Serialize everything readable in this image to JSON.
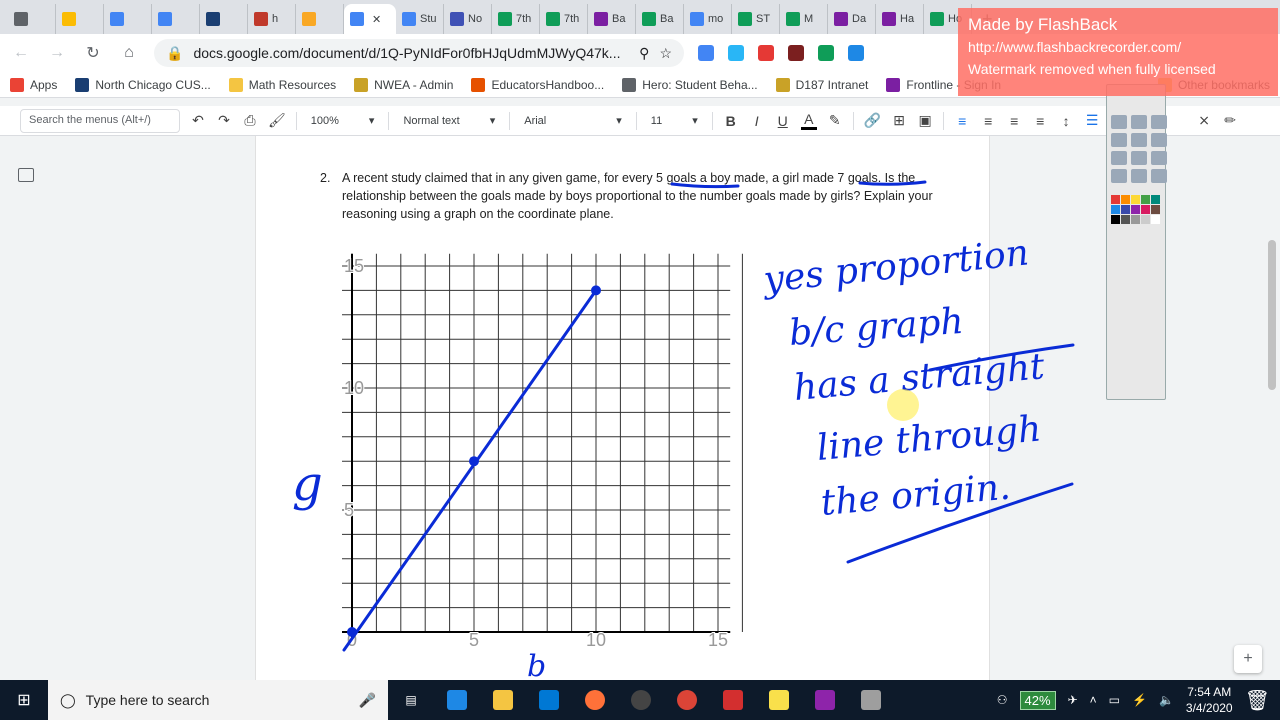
{
  "browser": {
    "tabs": [
      {
        "label": "",
        "color": "#5f6368"
      },
      {
        "label": "",
        "color": "#fbbc04"
      },
      {
        "label": "",
        "color": "#4285f4"
      },
      {
        "label": "",
        "color": "#4285f4"
      },
      {
        "label": "",
        "color": "#1a3e72"
      },
      {
        "label": "h",
        "color": "#c0392b"
      },
      {
        "label": "",
        "color": "#f9a825"
      },
      {
        "label": "",
        "color": "#4285f4",
        "active": true
      },
      {
        "label": "Stu",
        "color": "#4285f4"
      },
      {
        "label": "No",
        "color": "#3f51b5"
      },
      {
        "label": "7th",
        "color": "#0f9d58"
      },
      {
        "label": "7th",
        "color": "#0f9d58"
      },
      {
        "label": "Ba",
        "color": "#7b1fa2"
      },
      {
        "label": "Ba",
        "color": "#0f9d58"
      },
      {
        "label": "mo",
        "color": "#4285f4"
      },
      {
        "label": "ST",
        "color": "#0f9d58"
      },
      {
        "label": "M",
        "color": "#0f9d58"
      },
      {
        "label": "Da",
        "color": "#7b1fa2"
      },
      {
        "label": "Ha",
        "color": "#7b1fa2"
      },
      {
        "label": "Ho",
        "color": "#0f9d58"
      }
    ],
    "url": "docs.google.com/document/d/1Q-PyNIdFor0fbHJqUdmMJWyQ47k..."
  },
  "bookmarks": [
    "Apps",
    "North Chicago CUS...",
    "Math Resources",
    "NWEA - Admin",
    "EducatorsHandboo...",
    "Hero: Student Beha...",
    "D187 Intranet",
    "Frontline - Sign In",
    "Other bookmarks"
  ],
  "docs_toolbar": {
    "search_placeholder": "Search the menus (Alt+/)",
    "zoom": "100%",
    "style": "Normal text",
    "font": "Arial",
    "size": "11"
  },
  "document": {
    "question_number": "2.",
    "question_text": "A recent study claimed that in any given game, for every 5 goals a boy made, a girl made 7 goals. Is the relationship between the goals made by boys proportional to the number goals made by girls? Explain your reasoning using a graph on the coordinate plane."
  },
  "graph": {
    "x_ticks": [
      "0",
      "5",
      "10",
      "15"
    ],
    "y_ticks": [
      "5",
      "10",
      "15"
    ],
    "xmax": 15,
    "ymax": 15,
    "points": [
      [
        0,
        0
      ],
      [
        5,
        7
      ],
      [
        10,
        14
      ]
    ]
  },
  "handwriting": {
    "lines": [
      "yes proportion",
      "b/c graph",
      "has a straight",
      "line through",
      "the origin."
    ],
    "y_axis_label": "g",
    "x_axis_label": "b"
  },
  "watermark": {
    "line1": "Made by FlashBack",
    "line2": "http://www.flashbackrecorder.com/",
    "line3": "Watermark removed when fully licensed"
  },
  "taskbar": {
    "search_placeholder": "Type here to search",
    "battery": "42%",
    "time": "7:54 AM",
    "date": "3/4/2020"
  }
}
